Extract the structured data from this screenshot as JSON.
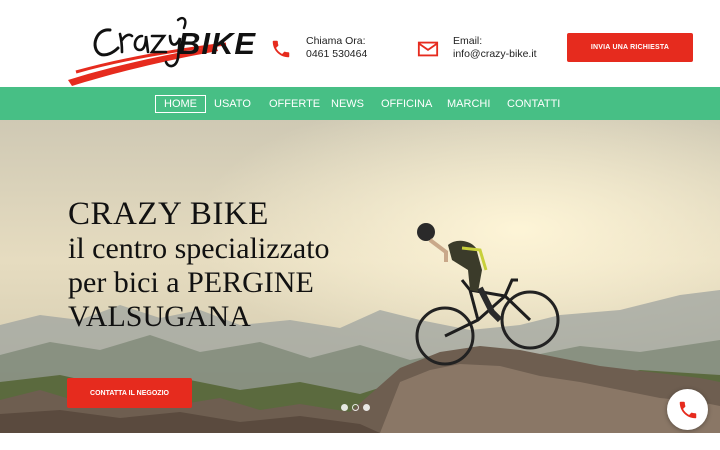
{
  "brand": {
    "logo_script": "Crazy",
    "logo_word": "BIKE",
    "colors": {
      "accent": "#e62b1e",
      "nav": "#47bf85",
      "text": "#111111"
    }
  },
  "header": {
    "phone": {
      "icon": "phone-icon",
      "label": "Chiama Ora:",
      "value": "0461 530464"
    },
    "email": {
      "icon": "envelope-icon",
      "label": "Email:",
      "value": "info@crazy-bike.it"
    },
    "cta_label": "INVIA UNA RICHIESTA"
  },
  "nav": {
    "items": [
      {
        "label": "HOME",
        "active": true
      },
      {
        "label": "USATO"
      },
      {
        "label": "OFFERTE"
      },
      {
        "label": "NEWS"
      },
      {
        "label": "OFFICINA"
      },
      {
        "label": "MARCHI"
      },
      {
        "label": "CONTATTI"
      }
    ]
  },
  "hero": {
    "title": "CRAZY BIKE",
    "subtitle_lines": [
      "il centro specializzato",
      "per bici a PERGINE",
      "VALSUGANA"
    ],
    "cta_label": "CONTATTA IL NEGOZIO",
    "slides": 3,
    "active_slide": 2
  },
  "floating_call": {
    "icon": "phone-icon"
  }
}
